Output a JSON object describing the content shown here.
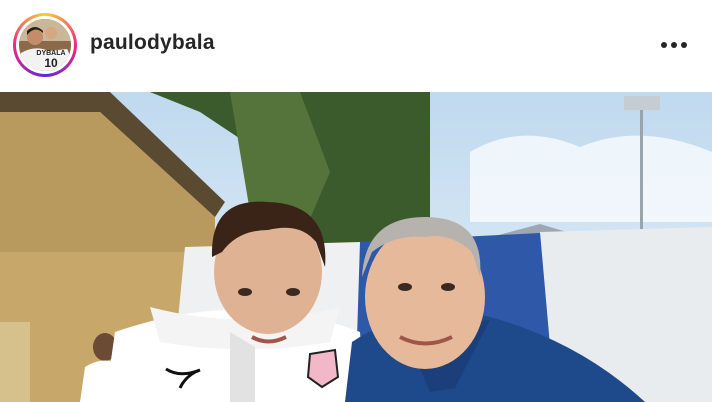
{
  "post": {
    "username": "paulodybala",
    "avatar_icon": "profile-avatar",
    "avatar_jersey_text": "DYBALA",
    "avatar_jersey_number": "10",
    "more_icon": "more-horizontal-icon"
  },
  "photo": {
    "icon": "post-photo"
  },
  "colors": {
    "ring_start": "#f9ce34",
    "ring_mid": "#ee2a7b",
    "ring_end": "#6228d7",
    "text": "#262626"
  }
}
